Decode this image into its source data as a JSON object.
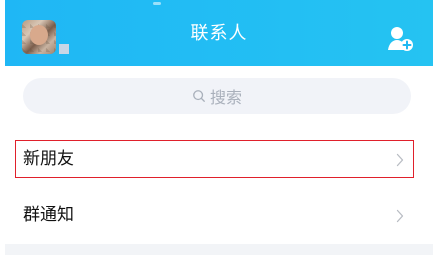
{
  "header": {
    "title": "联系人",
    "avatar": "user-avatar",
    "add_icon": "add-contact-icon",
    "accent_color": "#1fb7f5"
  },
  "search": {
    "placeholder": "搜索",
    "icon": "search-icon"
  },
  "list": {
    "items": [
      {
        "label": "新朋友",
        "icon": "chevron-right-icon"
      },
      {
        "label": "群通知",
        "icon": "chevron-right-icon"
      }
    ]
  },
  "annotation": {
    "highlight_color": "#e0202b"
  }
}
